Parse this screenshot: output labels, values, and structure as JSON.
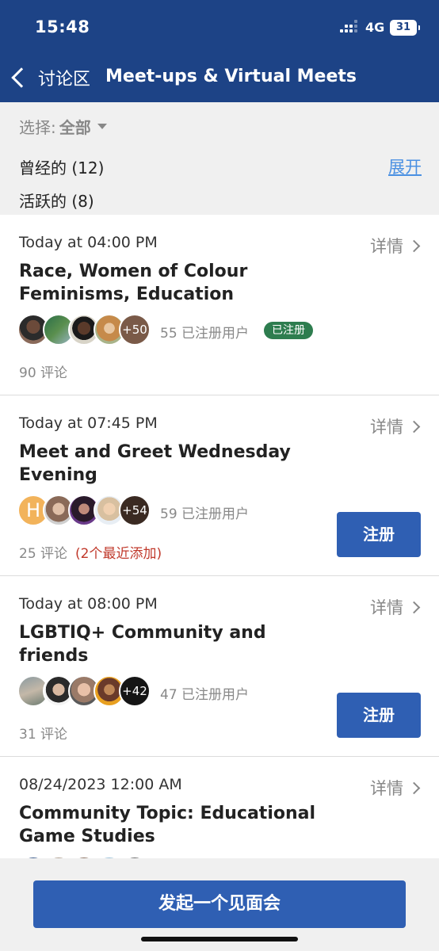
{
  "status_bar": {
    "time": "15:48",
    "network": "4G",
    "battery": "31"
  },
  "nav": {
    "back_label": "讨论区",
    "title": "Meet-ups & Virtual Meets"
  },
  "filter": {
    "label": "选择:",
    "value": "全部"
  },
  "sections": {
    "past": "曾经的 (12)",
    "expand": "展开",
    "active": "活跃的 (8)"
  },
  "common": {
    "details": "详情",
    "register": "注册",
    "registered_badge": "已注册"
  },
  "events": [
    {
      "time": "Today at 04:00 PM",
      "title": "Race, Women of Colour Feminisms, Education",
      "avatar_more": "+50",
      "registered_users": "55 已注册用户",
      "comments": "90 评论"
    },
    {
      "time": "Today at 07:45 PM",
      "title": "Meet and Greet Wednesday Evening",
      "avatar_letter": "H",
      "avatar_more": "+54",
      "registered_users": "59 已注册用户",
      "comments": "25 评论",
      "recent_note": "(2个最近添加)"
    },
    {
      "time": "Today at 08:00 PM",
      "title": "LGBTIQ+ Community and friends",
      "avatar_more": "+42",
      "registered_users": "47 已注册用户",
      "comments": "31 评论"
    },
    {
      "time": "08/24/2023 12:00 AM",
      "title": "Community Topic: Educational Game Studies"
    }
  ],
  "footer": {
    "start_meetup": "发起一个见面会"
  },
  "colors": {
    "header": "#1d4386",
    "button": "#2f5fb3",
    "badge": "#2e7d4f",
    "link": "#4a90e2",
    "note": "#c0392b"
  }
}
